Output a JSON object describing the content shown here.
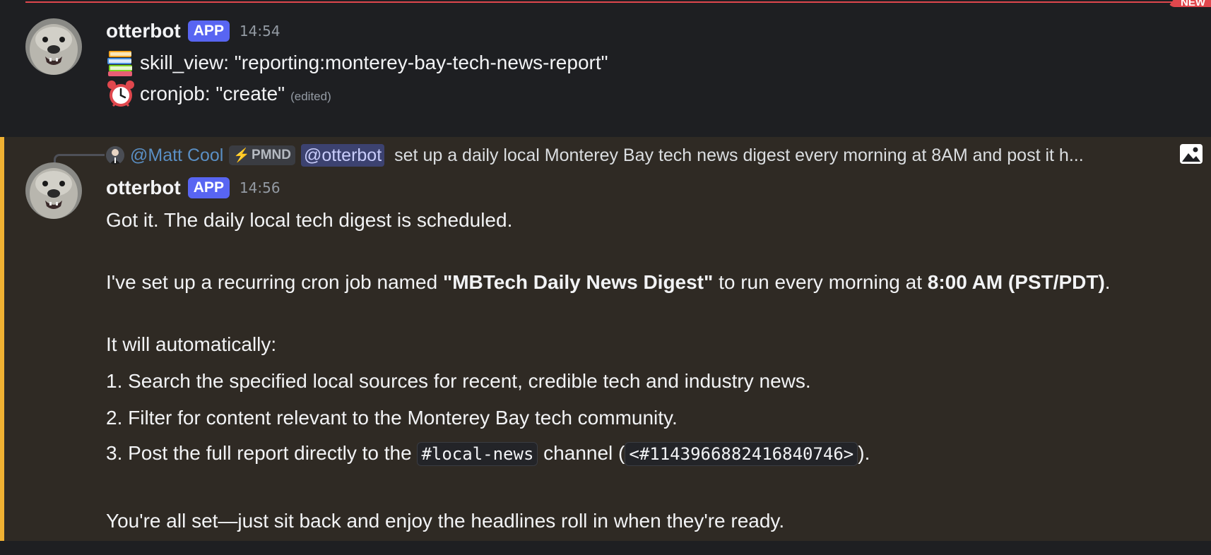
{
  "divider": {
    "label": "NEW"
  },
  "messages": [
    {
      "username": "otterbot",
      "badge": "APP",
      "time": "14:54",
      "lines": [
        {
          "emoji": "books-icon",
          "text": "skill_view: \"reporting:monterey-bay-tech-news-report\""
        },
        {
          "emoji": "alarm-clock-icon",
          "text": "cronjob: \"create\"",
          "edited": "(edited)"
        }
      ]
    },
    {
      "reply": {
        "name": "@Matt Cool",
        "role": "PMND",
        "mention": "@otterbot",
        "text": "set up a daily local Monterey Bay tech news digest every morning at 8AM and post it h..."
      },
      "username": "otterbot",
      "badge": "APP",
      "time": "14:56",
      "body": {
        "l1": "Got it. The daily local tech digest is scheduled.",
        "l2_a": "I've set up a recurring cron job named ",
        "l2_b": "\"MBTech Daily News Digest\"",
        "l2_c": " to run every morning at ",
        "l2_d": "8:00 AM (PST/PDT)",
        "l2_e": ".",
        "l3": "It will automatically:",
        "l4": "1. Search the specified local sources for recent, credible tech and industry news.",
        "l5": "2. Filter for content relevant to the Monterey Bay tech community.",
        "l6_a": "3. Post the full report directly to the ",
        "l6_code1": "#local-news",
        "l6_b": " channel (",
        "l6_code2": "<#1143966882416840746>",
        "l6_c": ").",
        "l7": "You're all set—just sit back and enjoy the headlines roll in when they're ready."
      }
    }
  ],
  "colors": {
    "accent": "#5865f2",
    "highlight_bar": "#f0b132",
    "new_divider": "#e0474d"
  }
}
